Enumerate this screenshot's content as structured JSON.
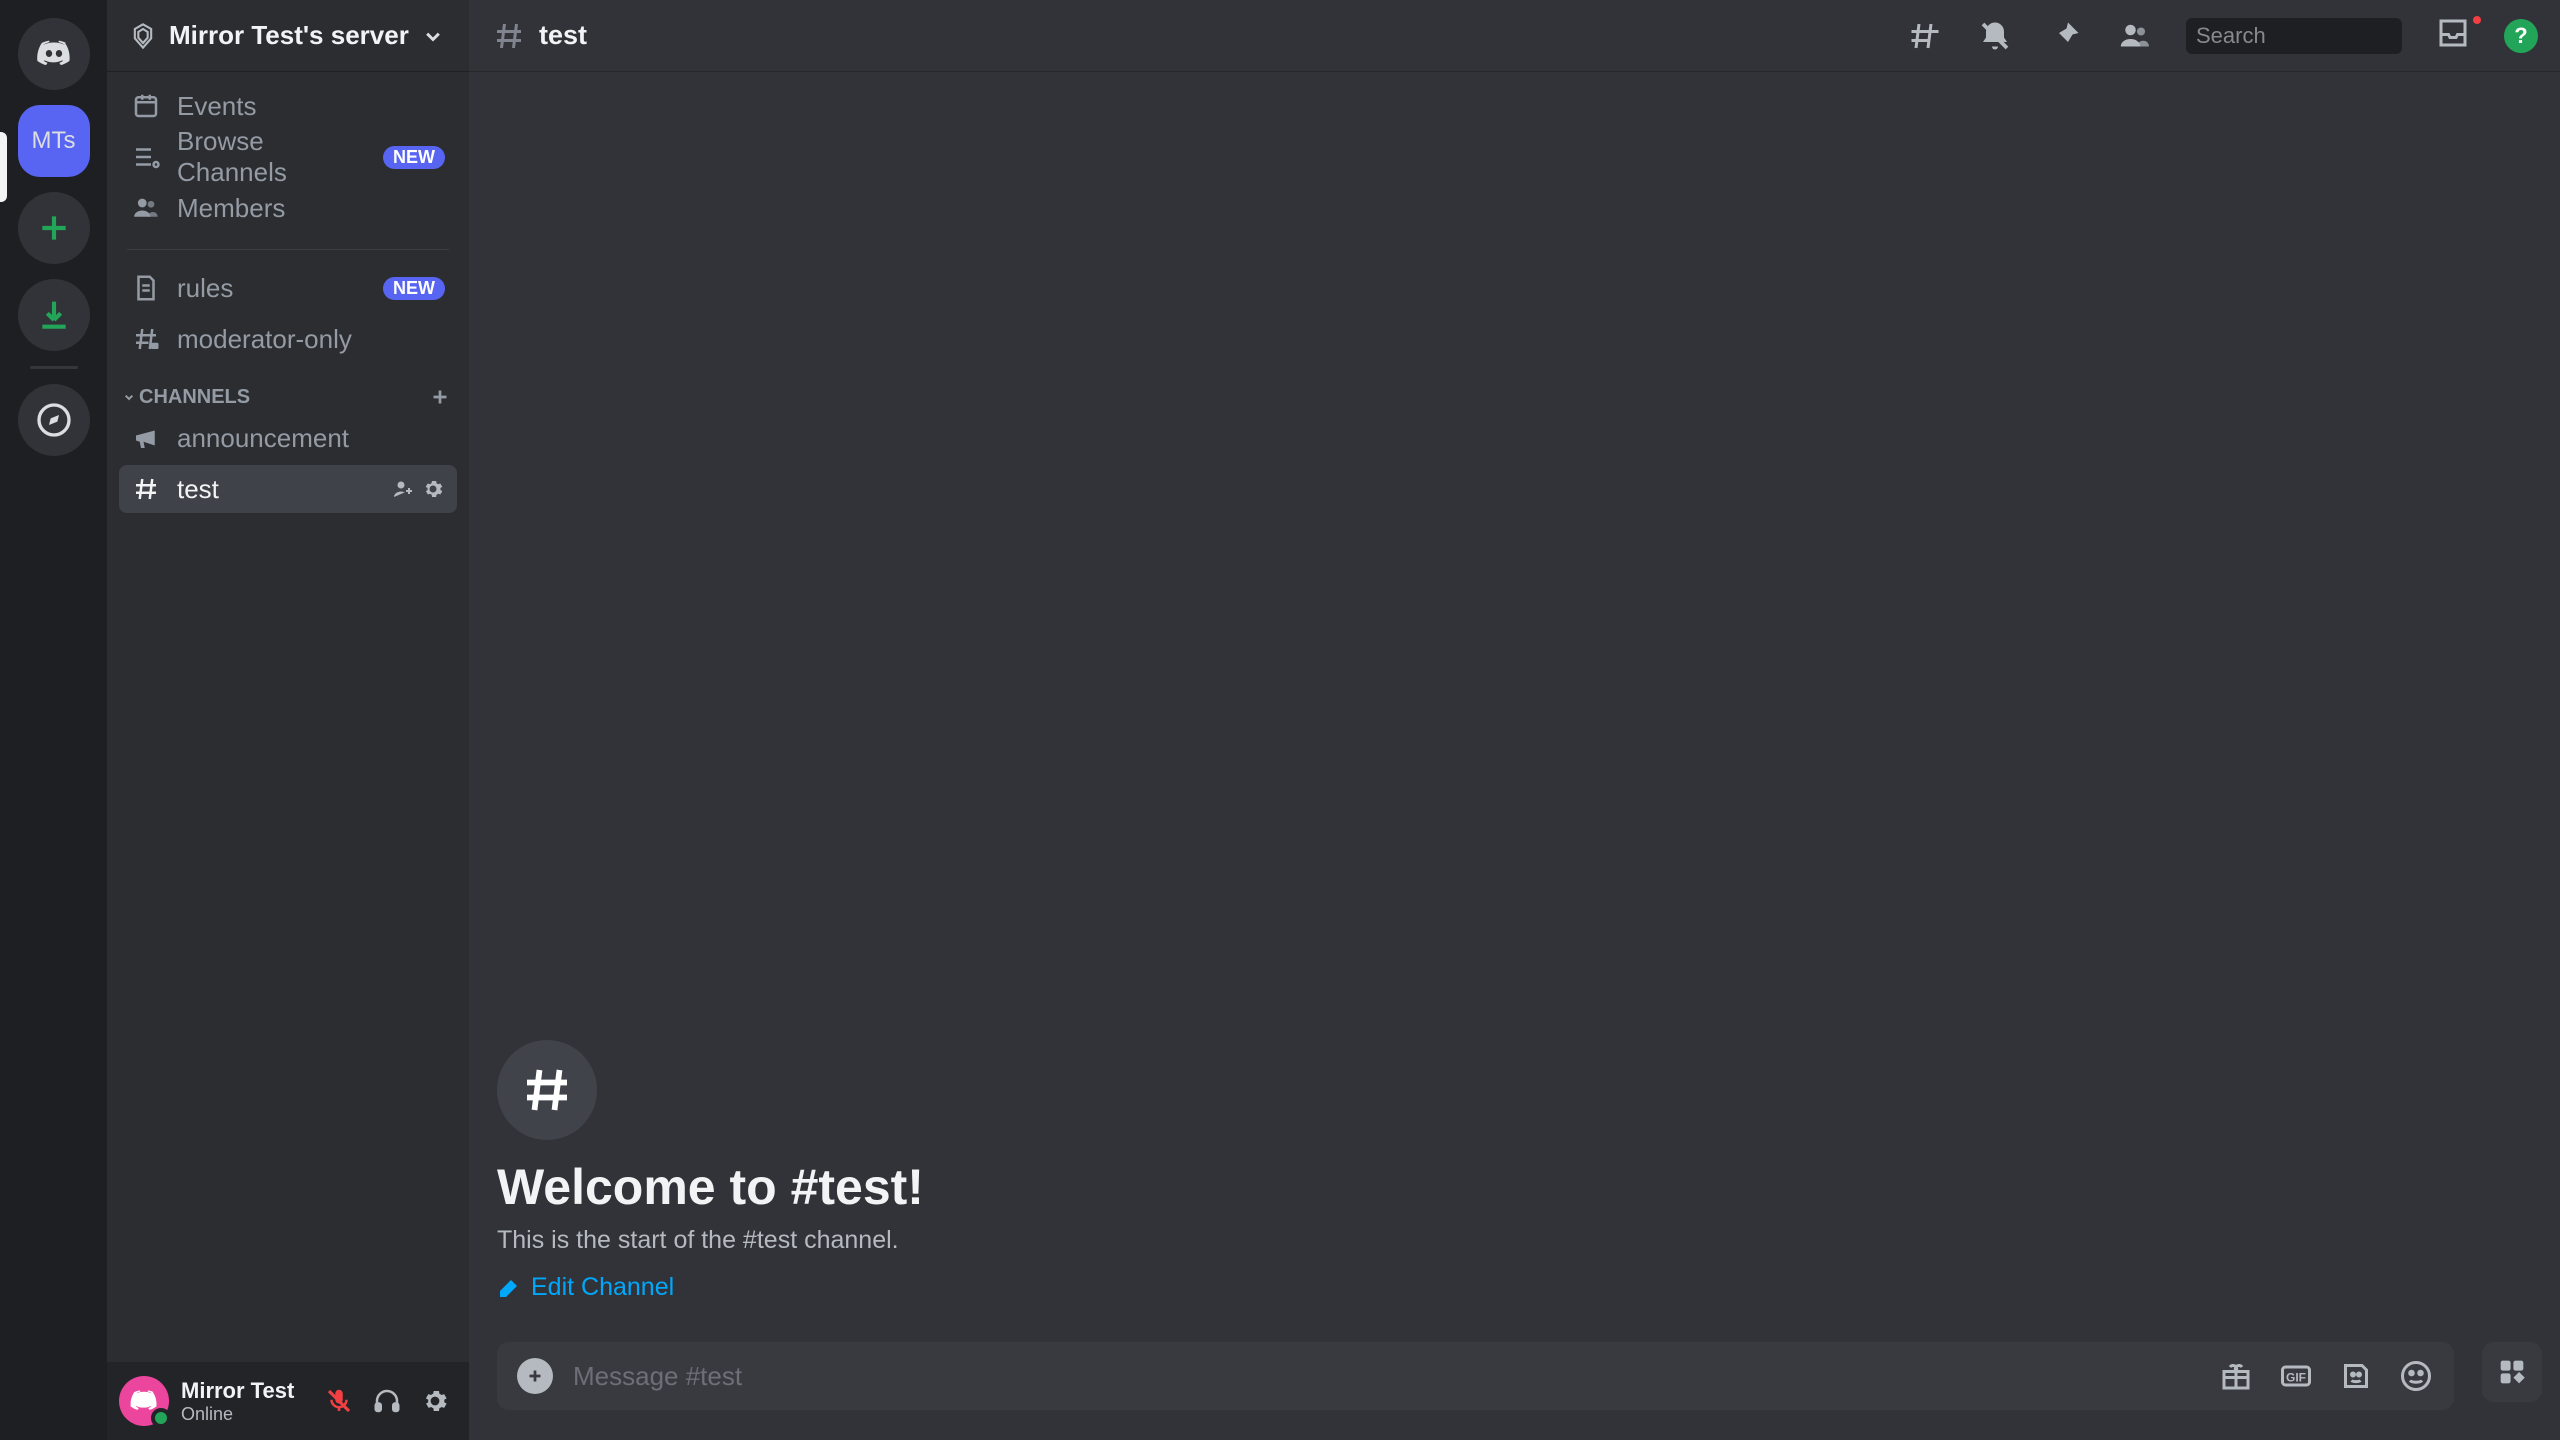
{
  "rail": {
    "server_initials": "MTs"
  },
  "sidebar": {
    "server_name": "Mirror Test's server",
    "events_label": "Events",
    "browse_label": "Browse Channels",
    "browse_badge": "NEW",
    "members_label": "Members",
    "rules_label": "rules",
    "rules_badge": "NEW",
    "moderator_label": "moderator-only",
    "category_label": "CHANNELS",
    "announcement_label": "announcement",
    "test_label": "test"
  },
  "user_panel": {
    "name": "Mirror Test",
    "status": "Online"
  },
  "topbar": {
    "channel_title": "test",
    "search_placeholder": "Search"
  },
  "welcome": {
    "title": "Welcome to #test!",
    "subtitle": "This is the start of the #test channel.",
    "edit_label": "Edit Channel"
  },
  "composer": {
    "placeholder": "Message #test"
  },
  "help": {
    "label": "?"
  }
}
